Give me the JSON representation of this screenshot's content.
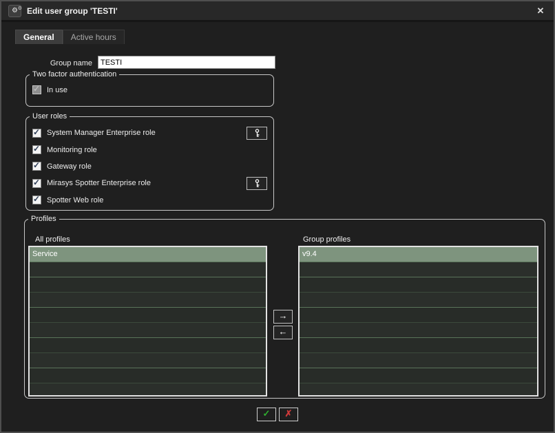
{
  "window": {
    "title": "Edit user group 'TESTI'",
    "icons": {
      "titlebar_gear": "⚙",
      "titlebar_gear_small": "⚙",
      "close": "✕"
    }
  },
  "tabs": [
    {
      "label": "General",
      "active": true
    },
    {
      "label": "Active hours",
      "active": false
    }
  ],
  "general_tab": {
    "group_name": {
      "label": "Group name",
      "value": "TESTI"
    },
    "two_factor": {
      "legend": "Two factor authentication",
      "in_use": {
        "label": "In use",
        "checked": false,
        "enabled": false
      }
    },
    "user_roles": {
      "legend": "User roles",
      "roles": [
        {
          "label": "System Manager Enterprise role",
          "checked": true,
          "key_button": true
        },
        {
          "label": "Monitoring role",
          "checked": true,
          "key_button": false
        },
        {
          "label": "Gateway role",
          "checked": true,
          "key_button": false
        },
        {
          "label": "Mirasys Spotter Enterprise role",
          "checked": true,
          "key_button": true
        },
        {
          "label": "Spotter Web role",
          "checked": true,
          "key_button": false
        }
      ]
    },
    "profiles": {
      "legend": "Profiles",
      "left_list": {
        "header": "All profiles",
        "items": [
          "Service"
        ],
        "selected": "Service"
      },
      "right_list": {
        "header": "Group profiles",
        "items": [
          "v9.4"
        ],
        "selected": "v9.4"
      },
      "move_buttons": {
        "right": "→",
        "left": "←"
      }
    }
  },
  "footer": {
    "ok": "✓",
    "cancel": "✗"
  },
  "colors": {
    "selected_row": "#7e947e",
    "ok_green": "#2fae2f",
    "cancel_red": "#d03a3a",
    "list_background": "#292c29",
    "window_background": "#1f1f1f"
  }
}
